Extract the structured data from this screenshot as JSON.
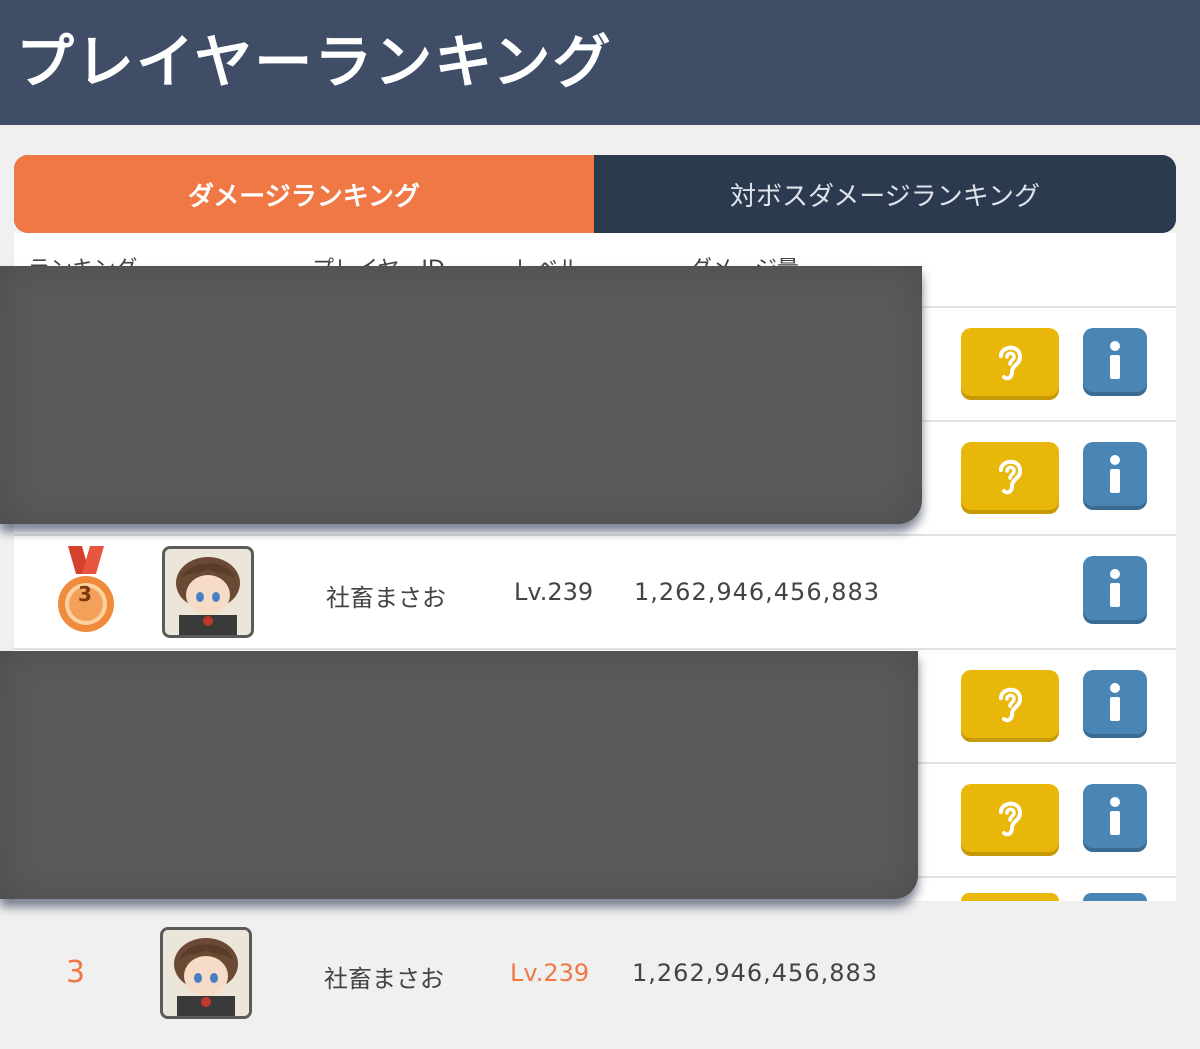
{
  "header": {
    "title": "プレイヤーランキング"
  },
  "tabs": [
    {
      "label": "ダメージランキング",
      "active": true
    },
    {
      "label": "対ボスダメージランキング",
      "active": false
    }
  ],
  "table": {
    "columns": [
      "ランキング",
      "プレイヤーID",
      "レベル",
      "ダメージ量"
    ],
    "visible_row": {
      "rank": "3",
      "player_id": "社畜まさお",
      "level": "Lv.239",
      "damage": "1,262,946,456,883"
    }
  },
  "bottom_row": {
    "rank": "3",
    "player_id": "社畜まさお",
    "level": "Lv.239",
    "damage": "1,262,946,456,883"
  },
  "colors": {
    "header_bg": "#3f4d66",
    "tab_active": "#ef7845",
    "tab_inactive": "#2c3a4f",
    "ear_button": "#e8b70a",
    "info_button": "#4a86b5",
    "rank_accent": "#ef7845"
  },
  "icons": [
    "ear-icon",
    "info-icon",
    "bronze-medal-icon"
  ]
}
